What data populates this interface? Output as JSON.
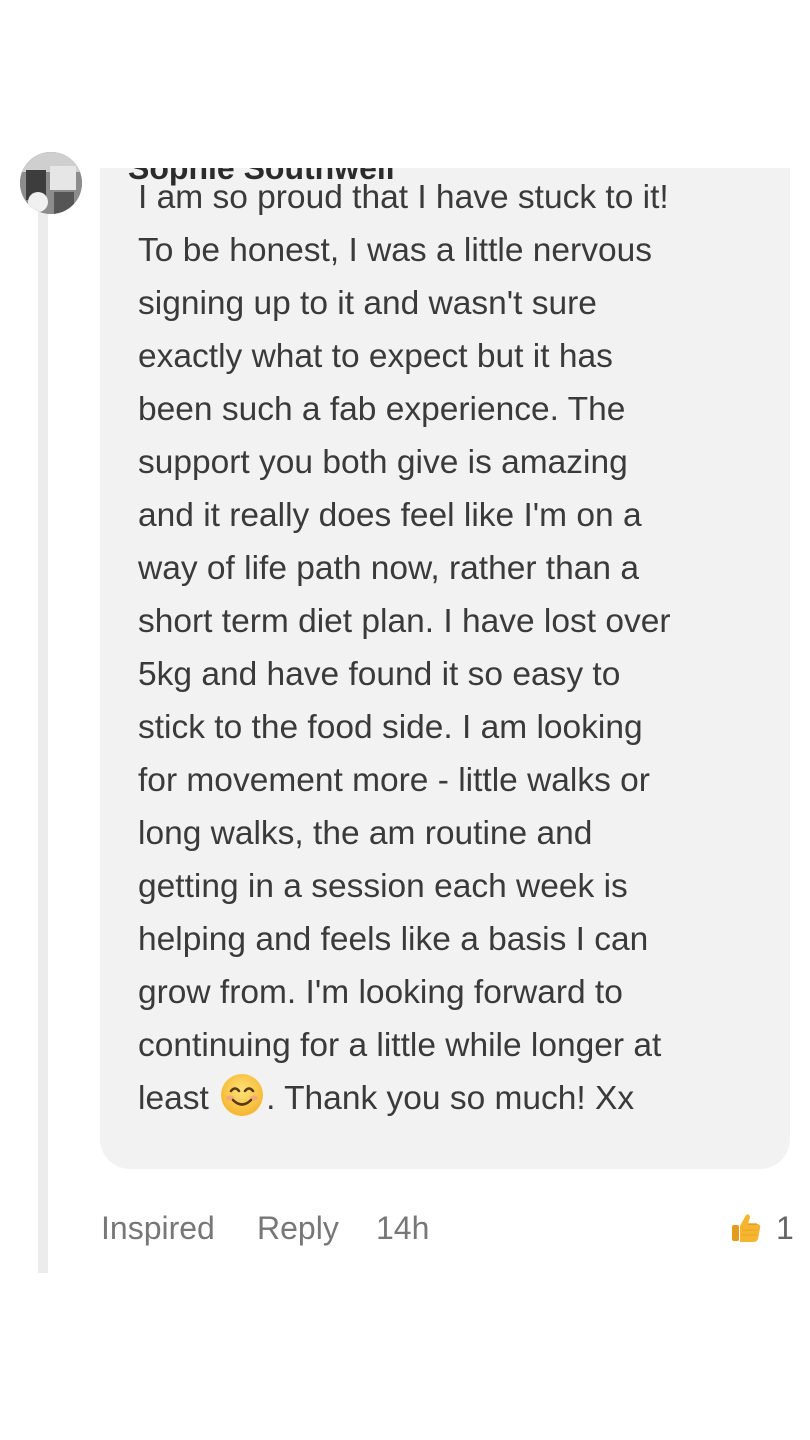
{
  "comment": {
    "author": "Sophie Southwell",
    "more_label": "•••",
    "body_lines": [
      "I am so proud that I have stuck to it!",
      "To be honest, I was a little nervous",
      "signing up to it and wasn't sure",
      "exactly what to expect but it has",
      "been such a fab experience. The",
      "support you both give is amazing",
      "and it really does feel like I'm on a",
      "way of life path now, rather than a",
      "short term diet plan. I have lost over",
      "5kg and have found it so easy to",
      "stick to the food side. I am looking",
      "for movement more - little walks or",
      "long walks, the am routine and",
      "getting in a session each week is",
      "helping and feels like a basis I can",
      "grow from. I'm looking forward to",
      "continuing for a little while longer at"
    ],
    "last_line_start": "least",
    "emoji_icon": "smiling-face-emoji",
    "last_line_end": ". Thank you so much! Xx"
  },
  "actions": {
    "react_label": "Inspired",
    "reply_label": "Reply",
    "timestamp": "14h",
    "like_icon": "thumbs-up-icon",
    "like_count": "1"
  },
  "colors": {
    "bubble": "#f2f2f2",
    "text": "#3a3a3a",
    "muted": "#777777",
    "thumb": "#f5b52e"
  }
}
